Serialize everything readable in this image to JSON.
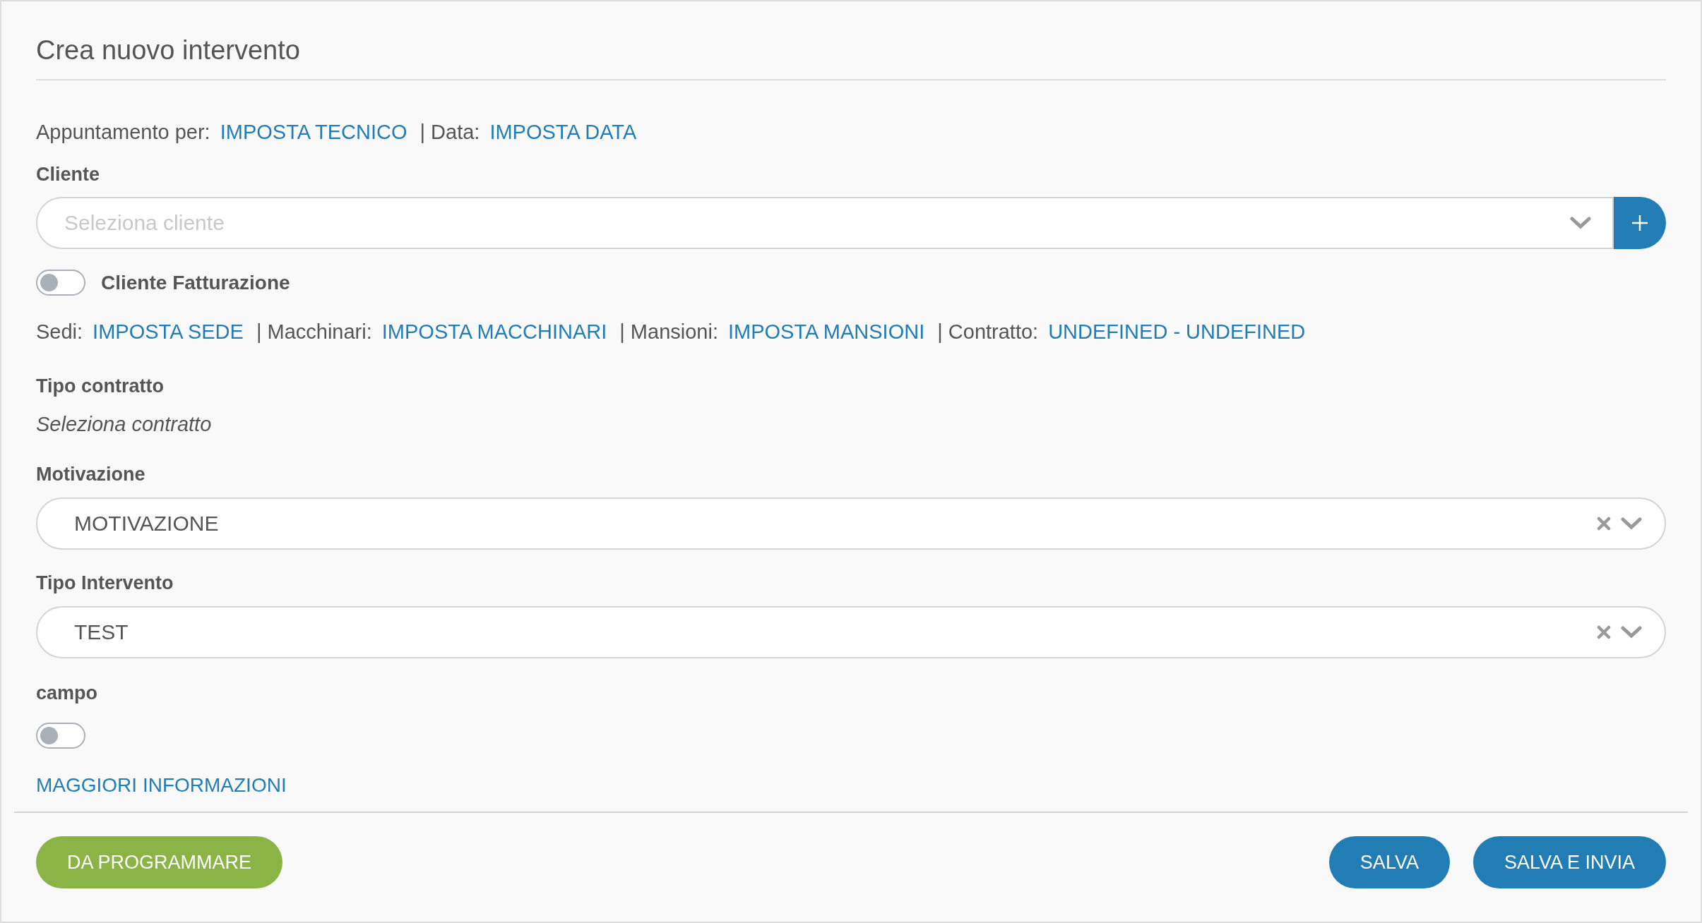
{
  "title": "Crea nuovo intervento",
  "appointment": [
    {
      "kind": "label",
      "text": "Appuntamento per:"
    },
    {
      "kind": "link",
      "text": "IMPOSTA TECNICO"
    },
    {
      "kind": "label",
      "text": "| Data:"
    },
    {
      "kind": "link",
      "text": "IMPOSTA DATA"
    }
  ],
  "cliente": {
    "label": "Cliente",
    "placeholder": "Seleziona cliente"
  },
  "billing_toggle": {
    "label": "Cliente Fatturazione",
    "on": false
  },
  "details": [
    {
      "kind": "label",
      "text": "Sedi:"
    },
    {
      "kind": "link",
      "text": "IMPOSTA SEDE"
    },
    {
      "kind": "label",
      "text": "| Macchinari:"
    },
    {
      "kind": "link",
      "text": "IMPOSTA MACCHINARI"
    },
    {
      "kind": "label",
      "text": "| Mansioni:"
    },
    {
      "kind": "link",
      "text": "IMPOSTA MANSIONI"
    },
    {
      "kind": "label",
      "text": "| Contratto:"
    },
    {
      "kind": "link",
      "text": "UNDEFINED - UNDEFINED"
    }
  ],
  "contract": {
    "label": "Tipo contratto",
    "value": "Seleziona contratto"
  },
  "selects": [
    {
      "label": "Motivazione",
      "value": "MOTIVAZIONE"
    },
    {
      "label": "Tipo Intervento",
      "value": "TEST"
    }
  ],
  "campo": {
    "label": "campo",
    "on": false
  },
  "more_link": "MAGGIORI INFORMAZIONI",
  "buttons": [
    {
      "label": "DA PROGRAMMARE",
      "kind": "green"
    },
    {
      "label": "SALVA",
      "kind": "blue"
    },
    {
      "label": "SALVA E INVIA",
      "kind": "blue"
    }
  ]
}
